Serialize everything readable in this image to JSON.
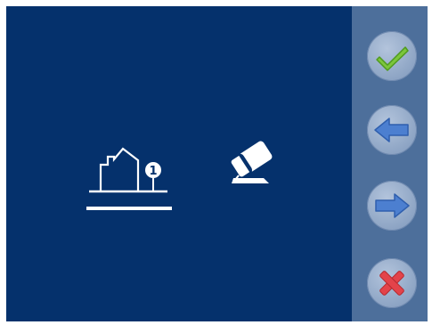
{
  "options": {
    "house": {
      "badge": "1",
      "selected": true,
      "icon": "house-icon"
    },
    "eraser": {
      "icon": "eraser-icon"
    }
  },
  "side_buttons": [
    {
      "name": "confirm",
      "icon": "check-icon",
      "color": "#7cc63c"
    },
    {
      "name": "previous",
      "icon": "arrow-left-icon",
      "color": "#4c7fd0"
    },
    {
      "name": "next",
      "icon": "arrow-right-icon",
      "color": "#4c7fd0"
    },
    {
      "name": "cancel",
      "icon": "x-icon",
      "color": "#e3434a"
    }
  ],
  "colors": {
    "background": "#05316c",
    "sidebar": "#4d6f9b",
    "foreground": "#ffffff"
  }
}
